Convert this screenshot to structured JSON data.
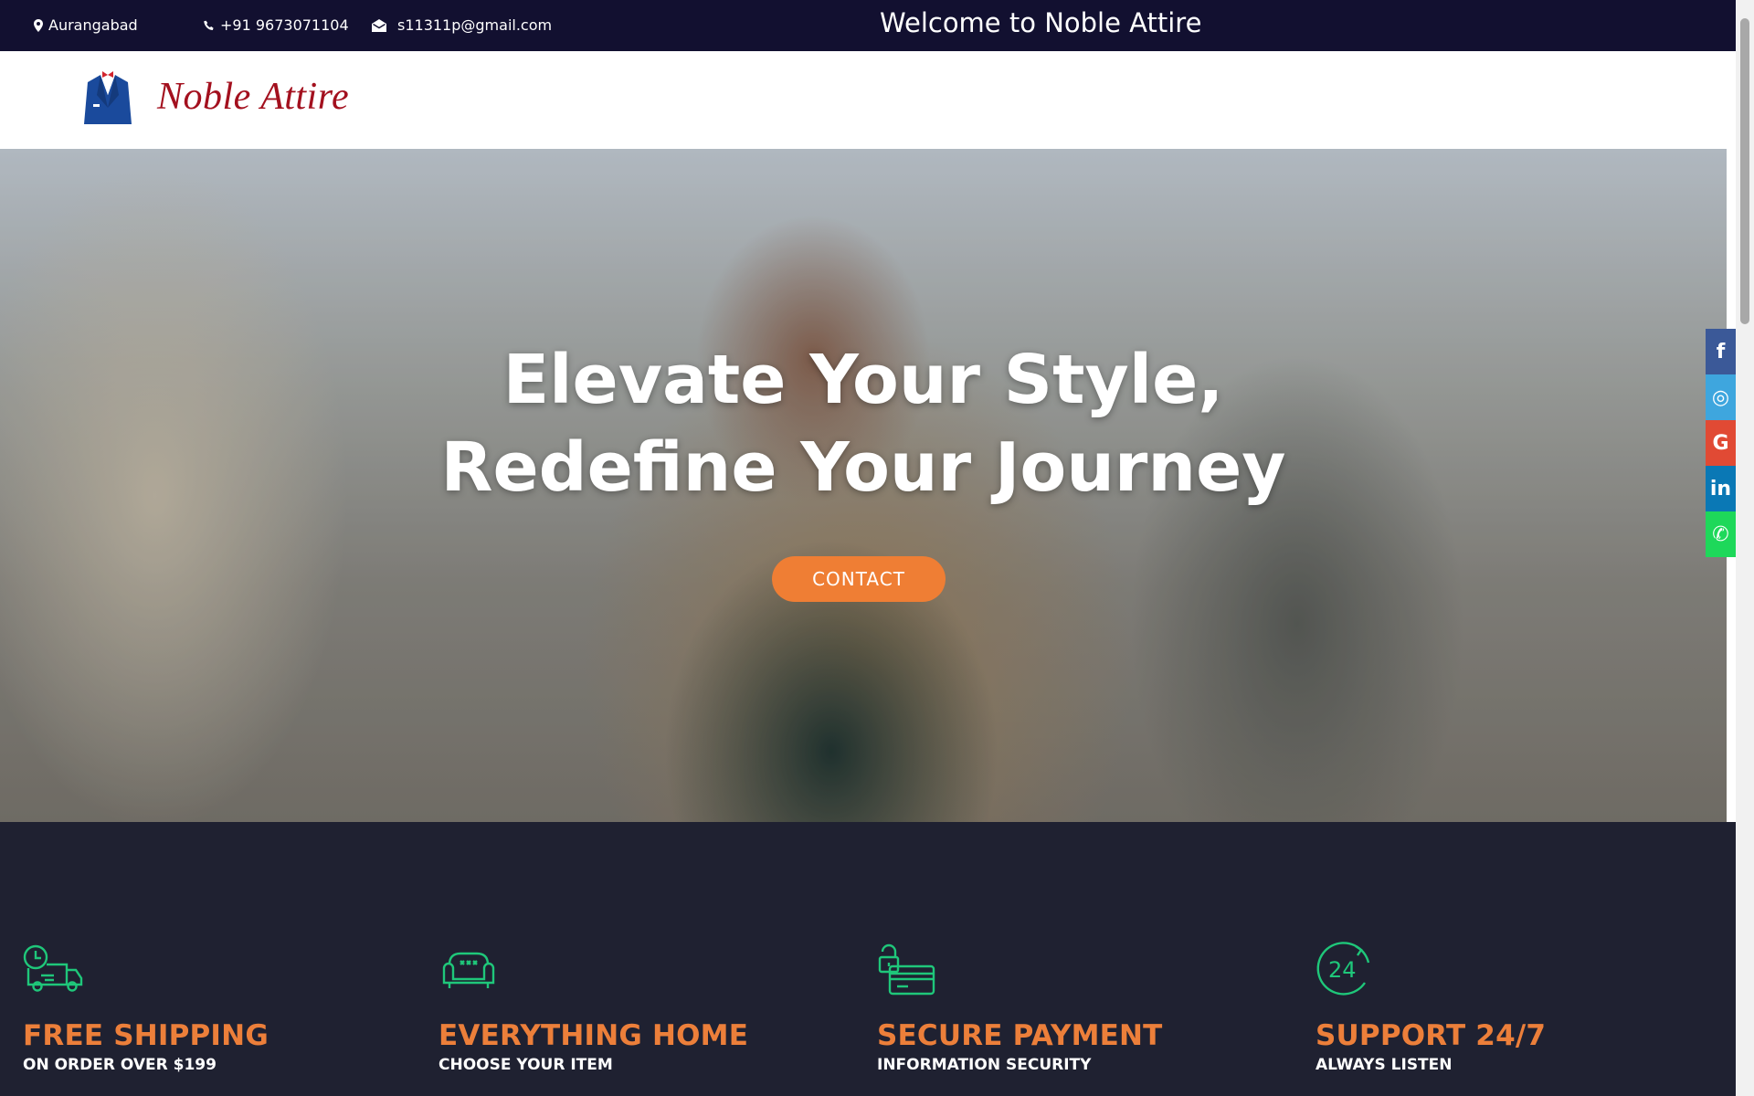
{
  "topbar": {
    "location": "Aurangabad",
    "phone": "+91 9673071104",
    "email": "s11311p@gmail.com",
    "welcome": "Welcome to Noble Attire"
  },
  "header": {
    "brand": "Noble Attire",
    "logo_icon": "suit-logo-icon"
  },
  "hero": {
    "heading_line1": "Elevate Your Style,",
    "heading_line2": "Redefine Your Journey",
    "cta_label": "CONTACT"
  },
  "social": [
    {
      "name": "facebook-icon",
      "glyph": "f",
      "color": "#3b5998"
    },
    {
      "name": "instagram-icon",
      "glyph": "◎",
      "color": "#3ea6de"
    },
    {
      "name": "google-icon",
      "glyph": "G",
      "color": "#e14a34"
    },
    {
      "name": "linkedin-icon",
      "glyph": "in",
      "color": "#0a78b5"
    },
    {
      "name": "whatsapp-icon",
      "glyph": "✆",
      "color": "#1ed85a"
    }
  ],
  "features": [
    {
      "icon": "delivery-truck-icon",
      "title": "FREE SHIPPING",
      "subtitle": "ON ORDER OVER $199"
    },
    {
      "icon": "sofa-icon",
      "title": "EVERYTHING HOME",
      "subtitle": "CHOOSE YOUR ITEM"
    },
    {
      "icon": "secure-card-icon",
      "title": "SECURE PAYMENT",
      "subtitle": "INFORMATION SECURITY"
    },
    {
      "icon": "support-24-icon",
      "title": "SUPPORT 24/7",
      "subtitle": "ALWAYS LISTEN"
    }
  ],
  "colors": {
    "topbar_bg": "#121030",
    "accent_orange": "#ef7e34",
    "feature_icon_green": "#1fc77a",
    "features_bg": "#1f2131"
  }
}
